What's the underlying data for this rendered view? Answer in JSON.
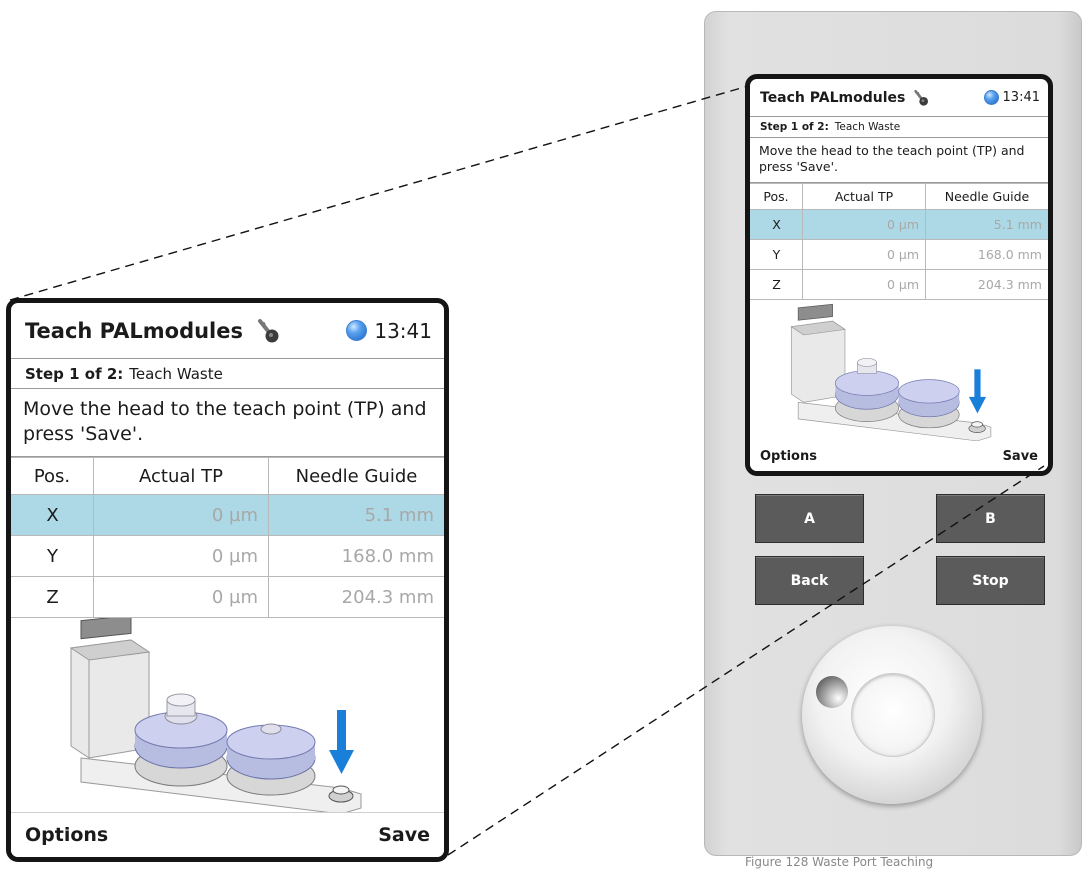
{
  "screen": {
    "title": "Teach PALmodules",
    "icon": "key-icon",
    "status_led_color": "#2f7fe0",
    "time": "13:41",
    "step_label": "Step 1 of 2:",
    "step_name": "Teach Waste",
    "message": "Move the head to the teach point (TP) and press 'Save'.",
    "table": {
      "headers": [
        "Pos.",
        "Actual TP",
        "Needle Guide"
      ],
      "rows": [
        {
          "pos": "X",
          "actual": "0 µm",
          "guide": "5.1 mm",
          "selected": true
        },
        {
          "pos": "Y",
          "actual": "0 µm",
          "guide": "168.0 mm",
          "selected": false
        },
        {
          "pos": "Z",
          "actual": "0 µm",
          "guide": "204.3 mm",
          "selected": false
        }
      ]
    },
    "footer_left": "Options",
    "footer_right": "Save"
  },
  "device": {
    "buttons": [
      "A",
      "B",
      "Back",
      "Stop"
    ],
    "knob": "rotary-knob"
  },
  "caption": "Figure 128 Waste Port Teaching"
}
